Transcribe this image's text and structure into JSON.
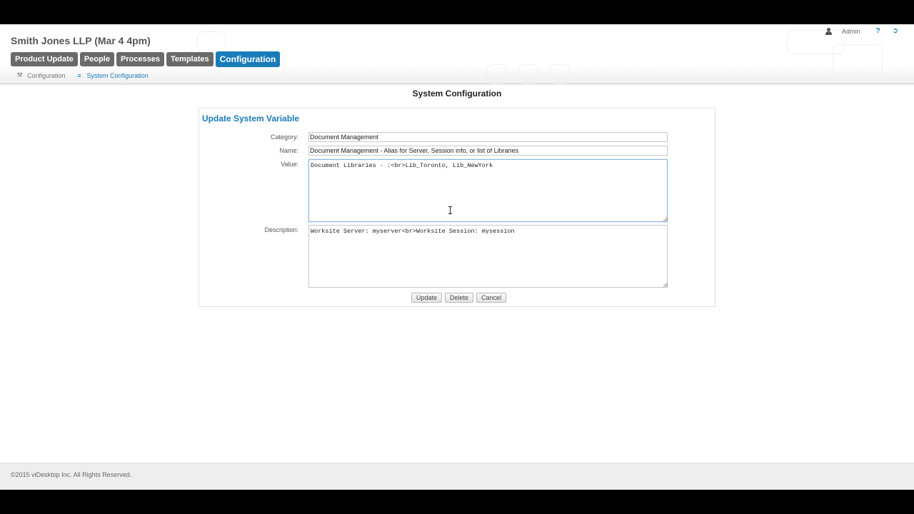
{
  "header": {
    "app_title": "Smith Jones LLP (Mar 4 4pm)",
    "nav": [
      {
        "label": "Product Update",
        "active": false
      },
      {
        "label": "People",
        "active": false
      },
      {
        "label": "Processes",
        "active": false
      },
      {
        "label": "Templates",
        "active": false
      },
      {
        "label": "Configuration",
        "active": true
      }
    ],
    "breadcrumb": [
      {
        "label": "Configuration",
        "icon": "tools-icon"
      },
      {
        "label": "System Configuration",
        "icon": "list-icon"
      }
    ],
    "user": {
      "name": "Admin",
      "help_icon": "help-icon",
      "logout_icon": "logout-icon"
    }
  },
  "page": {
    "title": "System Configuration"
  },
  "form": {
    "title": "Update System Variable",
    "category_label": "Category:",
    "category_value": "Document Management",
    "name_label": "Name:",
    "name_value": "Document Management - Alias for Server, Session info, or list of Libraries",
    "value_label": "Value:",
    "value_value": "Document Libraries - :<br>Lib_Toronto, Lib_NewYork",
    "description_label": "Description:",
    "description_value": "Worksite Server: myserver<br>Worksite Session: mysession",
    "buttons": {
      "update": "Update",
      "delete": "Delete",
      "cancel": "Cancel"
    }
  },
  "footer": {
    "copyright": "©2015 viDesktop Inc. All Rights Reserved."
  },
  "colors": {
    "accent": "#1a7bb9",
    "nav_inactive": "#6a6a6a"
  }
}
